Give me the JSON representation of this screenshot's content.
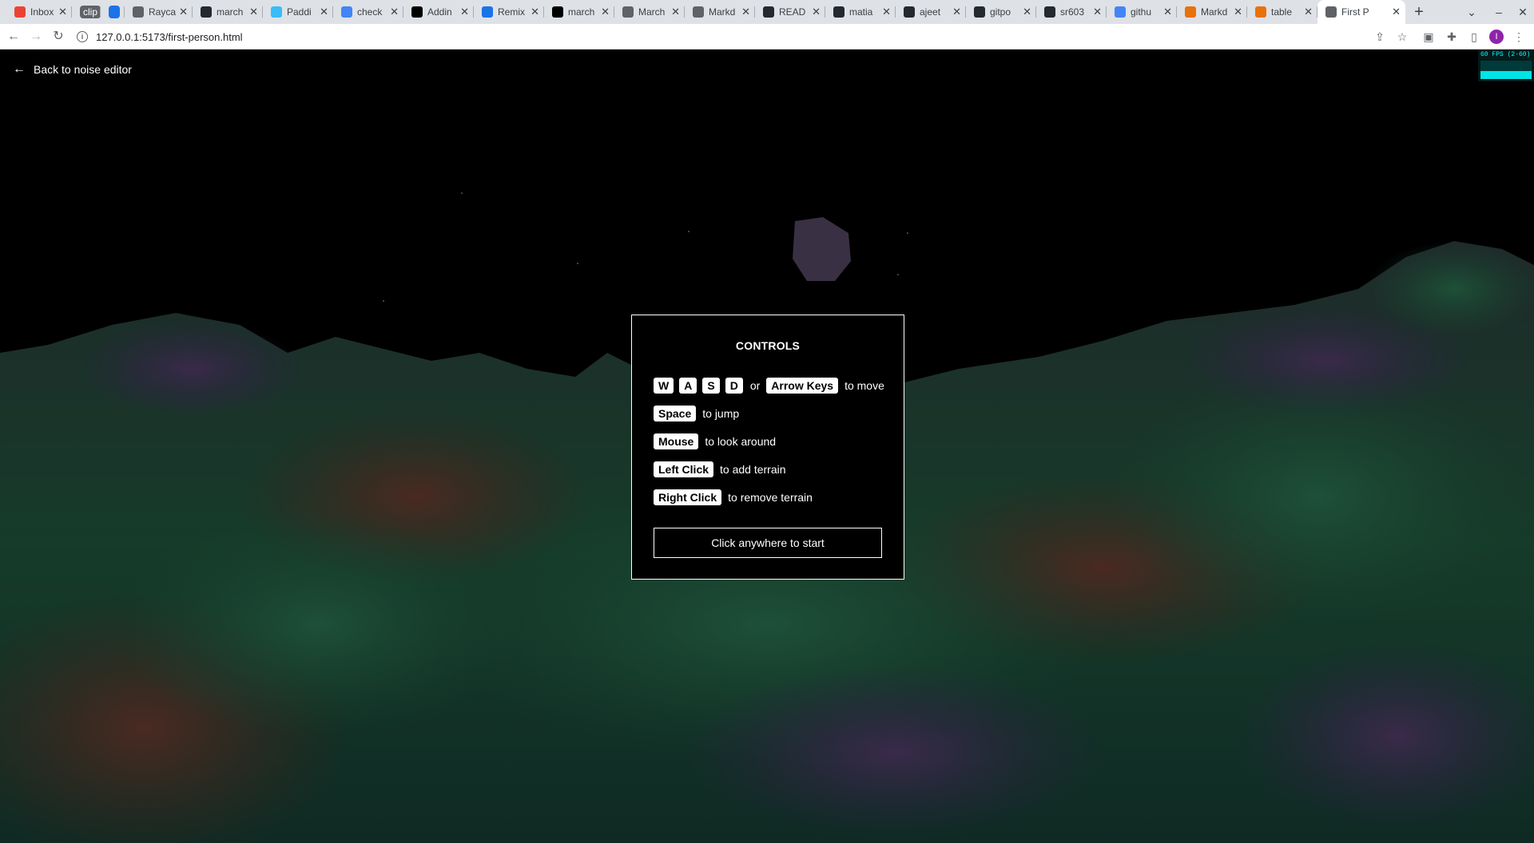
{
  "browser": {
    "tabs": [
      {
        "title": "Inbox",
        "favicon": "gmail-icon",
        "color": "#ea4335"
      },
      {
        "title": "clip",
        "favicon": "chip",
        "color": "#5f6368"
      },
      {
        "title": "",
        "favicon": "blue-chip",
        "color": "#1a73e8"
      },
      {
        "title": "Rayca",
        "favicon": "raycast-icon",
        "color": "#5f6368"
      },
      {
        "title": "march",
        "favicon": "github-icon",
        "color": "#24292f"
      },
      {
        "title": "Paddi",
        "favicon": "tailwind-icon",
        "color": "#38bdf8"
      },
      {
        "title": "check",
        "favicon": "google-icon",
        "color": "#4285f4"
      },
      {
        "title": "Addin",
        "favicon": "app-icon",
        "color": "#000000"
      },
      {
        "title": "Remix",
        "favicon": "remix-icon",
        "color": "#1a73e8"
      },
      {
        "title": "march",
        "favicon": "circle-icon",
        "color": "#000000"
      },
      {
        "title": "March",
        "favicon": "globe-icon",
        "color": "#5f6368"
      },
      {
        "title": "Markd",
        "favicon": "markdown-icon",
        "color": "#5f6368"
      },
      {
        "title": "READ",
        "favicon": "github-icon",
        "color": "#24292f"
      },
      {
        "title": "matia",
        "favicon": "github-icon",
        "color": "#24292f"
      },
      {
        "title": "ajeet",
        "favicon": "github-icon",
        "color": "#24292f"
      },
      {
        "title": "gitpo",
        "favicon": "github-icon",
        "color": "#24292f"
      },
      {
        "title": "sr603",
        "favicon": "github-icon",
        "color": "#24292f"
      },
      {
        "title": "githu",
        "favicon": "google-icon",
        "color": "#4285f4"
      },
      {
        "title": "Markd",
        "favicon": "app-icon",
        "color": "#e8710a"
      },
      {
        "title": "table",
        "favicon": "app-icon",
        "color": "#e8710a"
      },
      {
        "title": "First P",
        "favicon": "globe-icon",
        "color": "#5f6368",
        "active": true
      }
    ],
    "url": "127.0.0.1:5173/first-person.html"
  },
  "page": {
    "back_link": "Back to noise editor",
    "fps": {
      "label": "60 FPS (2-60)",
      "level": 0.45,
      "color": "#00ffff"
    }
  },
  "controls": {
    "title": "CONTROLS",
    "move_keys": [
      "W",
      "A",
      "S",
      "D"
    ],
    "or": "or",
    "arrow_keys": "Arrow Keys",
    "move_text": "to move",
    "jump_key": "Space",
    "jump_text": "to jump",
    "look_key": "Mouse",
    "look_text": "to look around",
    "add_key": "Left Click",
    "add_text": "to add terrain",
    "remove_key": "Right Click",
    "remove_text": "to remove terrain",
    "start_label": "Click anywhere to start"
  }
}
